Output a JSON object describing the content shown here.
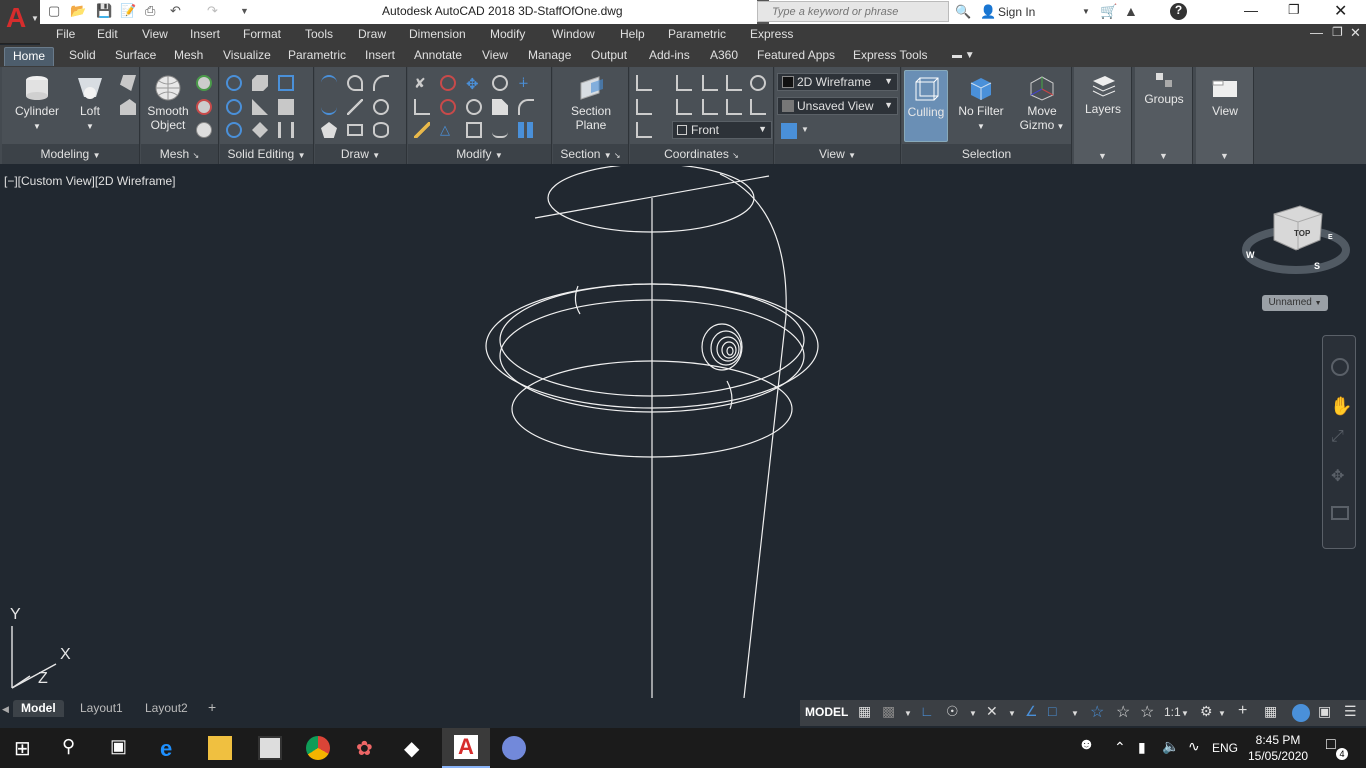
{
  "app": {
    "title": "Autodesk AutoCAD 2018    3D-StaffOfOne.dwg",
    "search_placeholder": "Type a keyword or phrase",
    "sign_in": "Sign In"
  },
  "menus": [
    "File",
    "Edit",
    "View",
    "Insert",
    "Format",
    "Tools",
    "Draw",
    "Dimension",
    "Modify",
    "Window",
    "Help",
    "Parametric",
    "Express"
  ],
  "ribbon_tabs": [
    "Home",
    "Solid",
    "Surface",
    "Mesh",
    "Visualize",
    "Parametric",
    "Insert",
    "Annotate",
    "View",
    "Manage",
    "Output",
    "Add-ins",
    "A360",
    "Featured Apps",
    "Express Tools"
  ],
  "ribbon": {
    "cylinder": "Cylinder",
    "loft": "Loft",
    "smooth_object_1": "Smooth",
    "smooth_object_2": "Object",
    "section_plane_1": "Section",
    "section_plane_2": "Plane",
    "visual_style": "2D Wireframe",
    "named_view": "Unsaved View",
    "view_direction": "Front",
    "culling": "Culling",
    "no_filter": "No Filter",
    "move_gizmo_1": "Move",
    "move_gizmo_2": "Gizmo",
    "layers": "Layers",
    "groups": "Groups",
    "view": "View",
    "panels": {
      "modeling": "Modeling",
      "mesh": "Mesh",
      "solid_editing": "Solid Editing",
      "draw": "Draw",
      "modify": "Modify",
      "section": "Section",
      "coordinates": "Coordinates",
      "view": "View",
      "selection": "Selection"
    }
  },
  "viewport": {
    "label": "[−][Custom View][2D Wireframe]",
    "viewcube_top": "TOP",
    "viewcube_name": "Unnamed",
    "ucs_y": "Y",
    "ucs_x": "X",
    "ucs_z": "Z",
    "compass_w": "W",
    "compass_s": "S",
    "compass_e": "E"
  },
  "layout_tabs": [
    "Model",
    "Layout1",
    "Layout2"
  ],
  "status": {
    "model": "MODEL",
    "scale": "1:1"
  },
  "taskbar": {
    "time": "8:45 PM",
    "date": "15/05/2020",
    "lang": "ENG",
    "notifications": "4"
  },
  "colors": {
    "accent": "#d62d2d",
    "ribbon_bg": "#444a50",
    "viewport_bg": "#212830"
  }
}
